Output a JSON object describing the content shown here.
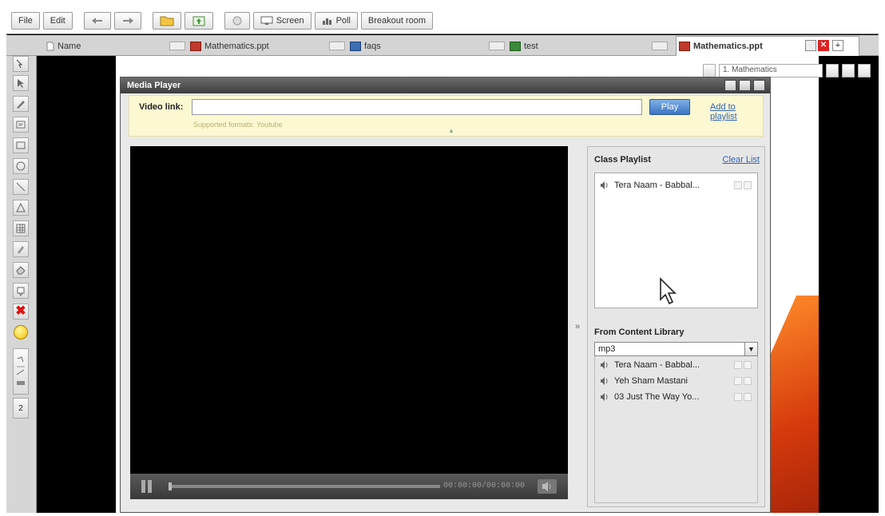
{
  "toolbar": {
    "file": "File",
    "edit": "Edit",
    "screen": "Screen",
    "poll": "Poll",
    "breakout": "Breakout room"
  },
  "tabs": [
    {
      "label": "Name",
      "type": "blank"
    },
    {
      "label": "Mathematics.ppt",
      "type": "ppt"
    },
    {
      "label": "faqs",
      "type": "doc"
    },
    {
      "label": "test",
      "type": "xls"
    },
    {
      "label": "Mathematics.ppt",
      "type": "ppt",
      "active": true
    }
  ],
  "slide_nav": {
    "current": "1. Mathematics"
  },
  "left_tools": {
    "page_number": "2"
  },
  "media_player": {
    "title": "Media Player",
    "video_link_label": "Video link:",
    "video_link_value": "",
    "play_label": "Play",
    "add_to_playlist": "Add to playlist",
    "supported_formats": "Supported formats: Youtube",
    "time_display": "00:00:00/00:00:00",
    "class_playlist_title": "Class Playlist",
    "clear_list": "Clear List",
    "class_playlist": [
      {
        "title": "Tera Naam - Babbal..."
      }
    ],
    "library_title": "From Content Library",
    "library_filter": "mp3",
    "library_items": [
      {
        "title": "Tera Naam - Babbal..."
      },
      {
        "title": "Yeh Sham Mastani"
      },
      {
        "title": "03 Just The Way Yo..."
      }
    ],
    "expand_arrow": "»"
  },
  "colors": {
    "accent_blue": "#3b74c2",
    "link_blue": "#2f63b8",
    "linkbar_bg": "#fcf8d2",
    "title_bar": "#4a4a4a"
  }
}
